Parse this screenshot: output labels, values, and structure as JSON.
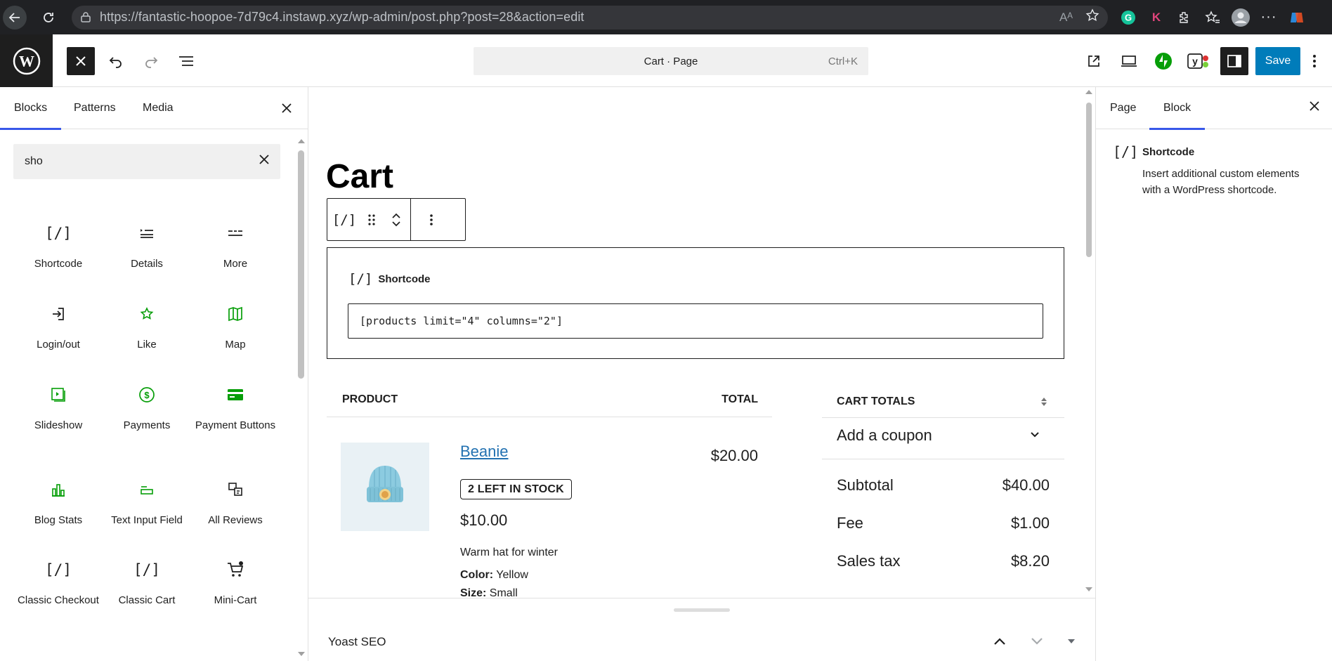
{
  "browser": {
    "url": "https://fantastic-hoopoe-7d79c4.instawp.xyz/wp-admin/post.php?post=28&action=edit"
  },
  "header": {
    "command_bar_title": "Cart · Page",
    "command_bar_shortcut": "Ctrl+K",
    "save_label": "Save"
  },
  "inserter": {
    "tabs": [
      {
        "label": "Blocks"
      },
      {
        "label": "Patterns"
      },
      {
        "label": "Media"
      }
    ],
    "search_value": "sho",
    "blocks": [
      {
        "label": "Shortcode",
        "icon": "shortcode-icon"
      },
      {
        "label": "Details",
        "icon": "details-icon"
      },
      {
        "label": "More",
        "icon": "more-icon"
      },
      {
        "label": "Login/out",
        "icon": "login-icon"
      },
      {
        "label": "Like",
        "icon": "star-icon"
      },
      {
        "label": "Map",
        "icon": "map-icon"
      },
      {
        "label": "Slideshow",
        "icon": "slideshow-icon"
      },
      {
        "label": "Payments",
        "icon": "payments-icon"
      },
      {
        "label": "Payment Buttons",
        "icon": "payment-buttons-icon"
      },
      {
        "label": "Blog Stats",
        "icon": "blog-stats-icon"
      },
      {
        "label": "Text Input Field",
        "icon": "text-input-icon"
      },
      {
        "label": "All Reviews",
        "icon": "all-reviews-icon"
      },
      {
        "label": "Classic Checkout",
        "icon": "shortcode-icon"
      },
      {
        "label": "Classic Cart",
        "icon": "shortcode-icon"
      },
      {
        "label": "Mini-Cart",
        "icon": "cart-icon"
      }
    ]
  },
  "canvas": {
    "page_title": "Cart",
    "shortcode_block": {
      "label": "Shortcode",
      "value": "[products limit=\"4\" columns=\"2\"]"
    },
    "cart": {
      "col_product": "PRODUCT",
      "col_total": "TOTAL",
      "item": {
        "name": "Beanie",
        "stock": "2 LEFT IN STOCK",
        "unit_price": "$10.00",
        "line_total": "$20.00",
        "description": "Warm hat for winter",
        "color_label": "Color:",
        "color_value": "Yellow",
        "size_label": "Size:",
        "size_value": "Small"
      }
    },
    "totals": {
      "title": "CART TOTALS",
      "coupon_label": "Add a coupon",
      "rows": [
        {
          "label": "Subtotal",
          "value": "$40.00"
        },
        {
          "label": "Fee",
          "value": "$1.00"
        },
        {
          "label": "Sales tax",
          "value": "$8.20"
        }
      ]
    }
  },
  "meta_boxes": {
    "yoast_title": "Yoast SEO"
  },
  "sidebar": {
    "tabs": [
      {
        "label": "Page"
      },
      {
        "label": "Block"
      }
    ],
    "block_title": "Shortcode",
    "block_description": "Insert additional custom elements with a WordPress shortcode."
  },
  "colors": {
    "accent": "#3858e9",
    "save_button": "#007cba",
    "icon_green": "#069e08",
    "link": "#2271b1"
  }
}
